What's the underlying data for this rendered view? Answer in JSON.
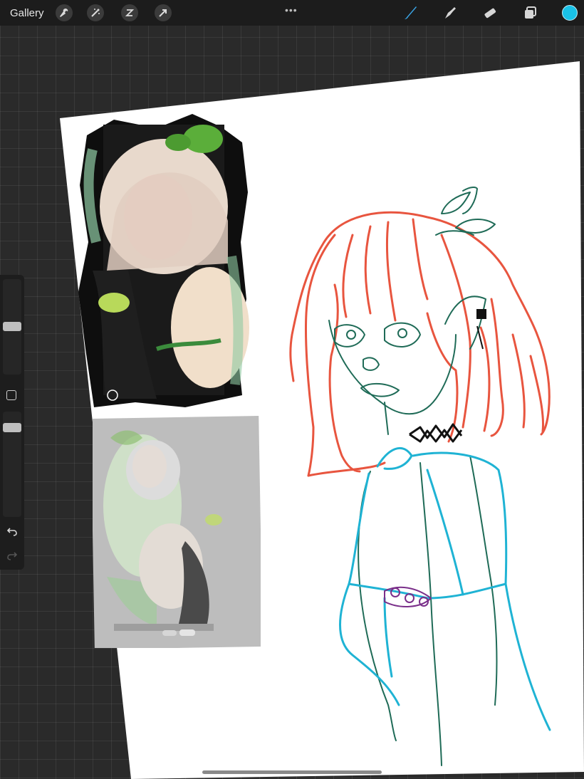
{
  "toolbar": {
    "gallery_label": "Gallery",
    "left_tools": [
      "wrench-icon",
      "magic-wand-icon",
      "selection-icon",
      "transform-arrow-icon"
    ],
    "more_label": "•••",
    "right_tools": [
      "brush-icon",
      "smudge-icon",
      "eraser-icon",
      "layers-icon"
    ],
    "active_color": "#19c2e8"
  },
  "sidebar": {
    "brush_size_level": 0.36,
    "opacity_level": 0.08,
    "tools": [
      "modify-button",
      "undo-icon",
      "redo-icon"
    ]
  },
  "colors": {
    "hair_stroke": "#e8553f",
    "face_stroke": "#1f6b57",
    "body_stroke": "#1fb3d4",
    "accent_stroke": "#7a2f8a",
    "paper": "#ffffff",
    "background": "#2a2a2a"
  }
}
